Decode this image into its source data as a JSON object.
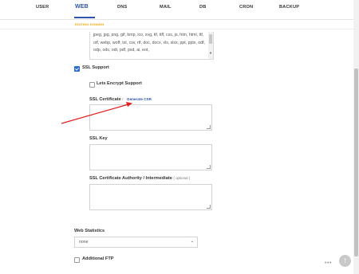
{
  "nav": {
    "tabs": [
      {
        "label": "USER"
      },
      {
        "label": "WEB"
      },
      {
        "label": "DNS"
      },
      {
        "label": "MAIL"
      },
      {
        "label": "DB"
      },
      {
        "label": "CRON"
      },
      {
        "label": "BACKUP"
      }
    ],
    "active_tab": "WEB",
    "subnav_label": "EDITING DOMAIN"
  },
  "form": {
    "extensions_text": "jpeg, jpg, png, gif, bmp, ico, svg, tif, tiff, css, js, htm, html, ttf, otf, webp, woff, txt, csv, rtf, doc, docx, xls, xlsx, ppt, pptx, odf, odp, ods, odt, pdf, psd, ai, eot,",
    "ssl_support": {
      "label": "SSL Support",
      "checked": true
    },
    "lets_encrypt": {
      "label": "Lets Encrypt Support",
      "checked": false
    },
    "ssl_certificate": {
      "label": "SSL Certificate",
      "sep": "/",
      "generate_csr_link": "Generate CSR",
      "value": ""
    },
    "ssl_key": {
      "label": "SSL Key",
      "value": ""
    },
    "ssl_ca": {
      "label": "SSL Certificate Authority / Intermediate",
      "optional_note": "( optional )",
      "value": ""
    },
    "web_statistics": {
      "label": "Web Statistics",
      "selected": "none"
    },
    "additional_ftp": {
      "label": "Additional FTP",
      "checked": false
    }
  },
  "footer": {
    "more_dots": "•••",
    "scroll_top_icon": "up-arrow-icon"
  },
  "colors": {
    "accent": "#2c54ac",
    "subnav": "#f0a500",
    "checkbox_checked": "#2c6dd5",
    "annotation_arrow": "#e02020"
  }
}
